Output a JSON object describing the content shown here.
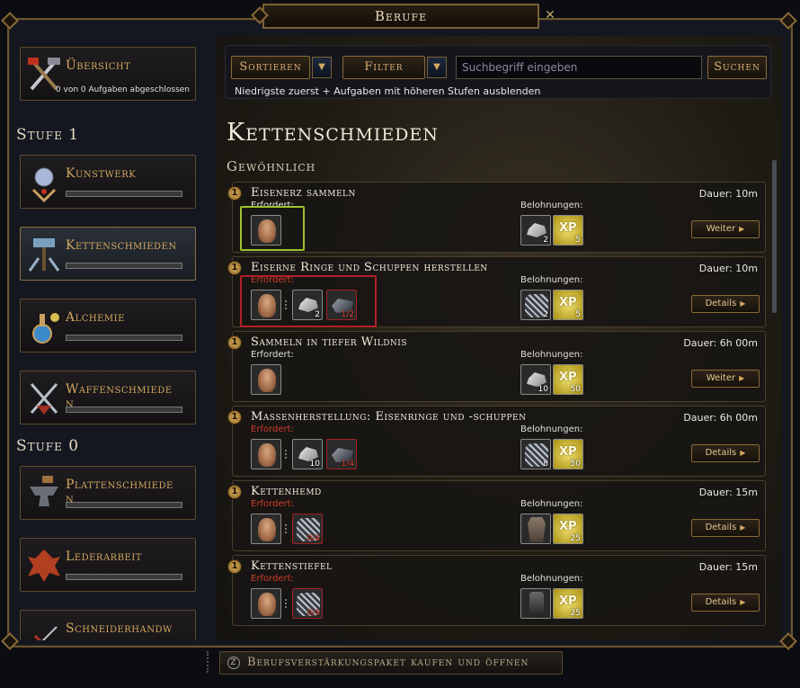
{
  "window": {
    "title": "Berufe"
  },
  "sidebar": {
    "overview": {
      "label": "Übersicht",
      "sub": "0 von 0 Aufgaben abgeschlossen"
    },
    "stages": [
      {
        "label": "Stufe 1",
        "items": [
          {
            "label": "Kunstwerk",
            "icon": "orb-icon",
            "progress": 0
          },
          {
            "label": "Kettenschmieden",
            "icon": "chain-hammer-icon",
            "progress": 0,
            "active": true
          },
          {
            "label": "Alchemie",
            "icon": "potion-icon",
            "progress": 0
          },
          {
            "label": "Waffenschmiede\nn",
            "icon": "crossed-swords-icon",
            "progress": 0
          }
        ]
      },
      {
        "label": "Stufe 0",
        "items": [
          {
            "label": "Plattenschmiede\nn",
            "icon": "anvil-icon",
            "progress": 0
          },
          {
            "label": "Lederarbeit",
            "icon": "leather-icon",
            "progress": 0
          },
          {
            "label": "Schneiderhandw",
            "icon": "needle-icon",
            "progress": 0
          }
        ]
      }
    ]
  },
  "toolbar": {
    "sort_label": "Sortieren",
    "filter_label": "Filter",
    "search_placeholder": "Suchbegriff eingeben",
    "search_button": "Suchen",
    "note": "Niedrigste zuerst + Aufgaben mit höheren Stufen ausblenden"
  },
  "main": {
    "title": "Kettenschmieden",
    "category": "Gewöhnlich",
    "tasks": [
      {
        "level": "1",
        "name": "Eisenerz sammeln",
        "required_label": "Erfordert:",
        "required_red": false,
        "rewards_label": "Belohnungen:",
        "duration": "Dauer: 10m",
        "required": [
          {
            "icon": "worker-portrait-icon",
            "count": ""
          }
        ],
        "rewards": [
          {
            "icon": "iron-ore-icon",
            "count": "2"
          },
          {
            "icon": "xp-icon",
            "count": "5"
          }
        ],
        "action": "Weiter"
      },
      {
        "level": "1",
        "name": "Eiserne Ringe und Schuppen herstellen",
        "required_label": "Erfordert:",
        "required_red": true,
        "rewards_label": "Belohnungen:",
        "duration": "Dauer: 10m",
        "required": [
          {
            "icon": "worker-portrait-icon",
            "count": ""
          },
          {
            "icon": "iron-ore-icon",
            "count": "2"
          },
          {
            "icon": "charcoal-icon",
            "count": "1/2",
            "missing": true
          }
        ],
        "rewards": [
          {
            "icon": "iron-rings-icon",
            "count": "2"
          },
          {
            "icon": "xp-icon",
            "count": "5"
          }
        ],
        "action": "Details"
      },
      {
        "level": "1",
        "name": "Sammeln in tiefer Wildnis",
        "required_label": "Erfordert:",
        "required_red": false,
        "rewards_label": "Belohnungen:",
        "duration": "Dauer: 6h 00m",
        "required": [
          {
            "icon": "worker-portrait-icon",
            "count": ""
          }
        ],
        "rewards": [
          {
            "icon": "iron-ore-icon",
            "count": "10"
          },
          {
            "icon": "xp-icon",
            "count": "50"
          }
        ],
        "action": "Weiter"
      },
      {
        "level": "1",
        "name": "Massenherstellung: Eisenringe und -schuppen",
        "required_label": "Erfordert:",
        "required_red": true,
        "rewards_label": "Belohnungen:",
        "duration": "Dauer: 6h 00m",
        "required": [
          {
            "icon": "worker-portrait-icon",
            "count": ""
          },
          {
            "icon": "iron-ore-icon",
            "count": "10"
          },
          {
            "icon": "charcoal-icon",
            "count": "1/4",
            "missing": true
          }
        ],
        "rewards": [
          {
            "icon": "iron-rings-icon",
            "count": "8"
          },
          {
            "icon": "xp-icon",
            "count": "50"
          }
        ],
        "action": "Details"
      },
      {
        "level": "1",
        "name": "Kettenhemd",
        "required_label": "Erfordert:",
        "required_red": true,
        "rewards_label": "Belohnungen:",
        "duration": "Dauer: 15m",
        "required": [
          {
            "icon": "worker-portrait-icon",
            "count": ""
          },
          {
            "icon": "iron-rings-icon",
            "count": "0/4",
            "missing": true
          }
        ],
        "rewards": [
          {
            "icon": "chain-shirt-icon",
            "count": ""
          },
          {
            "icon": "xp-icon",
            "count": "25"
          }
        ],
        "action": "Details"
      },
      {
        "level": "1",
        "name": "Kettenstiefel",
        "required_label": "Erfordert:",
        "required_red": true,
        "rewards_label": "Belohnungen:",
        "duration": "Dauer: 15m",
        "required": [
          {
            "icon": "worker-portrait-icon",
            "count": ""
          },
          {
            "icon": "iron-rings-icon",
            "count": "0/4",
            "missing": true
          }
        ],
        "rewards": [
          {
            "icon": "chain-boots-icon",
            "count": ""
          },
          {
            "icon": "xp-icon",
            "count": "25"
          }
        ],
        "action": "Details"
      }
    ],
    "xp_text": "XP"
  },
  "footer": {
    "label": "Berufsverstärkungspaket kaufen und öffnen",
    "icon_text": "Z"
  },
  "colors": {
    "gold": "#d4a860",
    "missing_red": "#d03a2a",
    "highlight_green": "#a0c030",
    "highlight_red": "#b02028"
  }
}
